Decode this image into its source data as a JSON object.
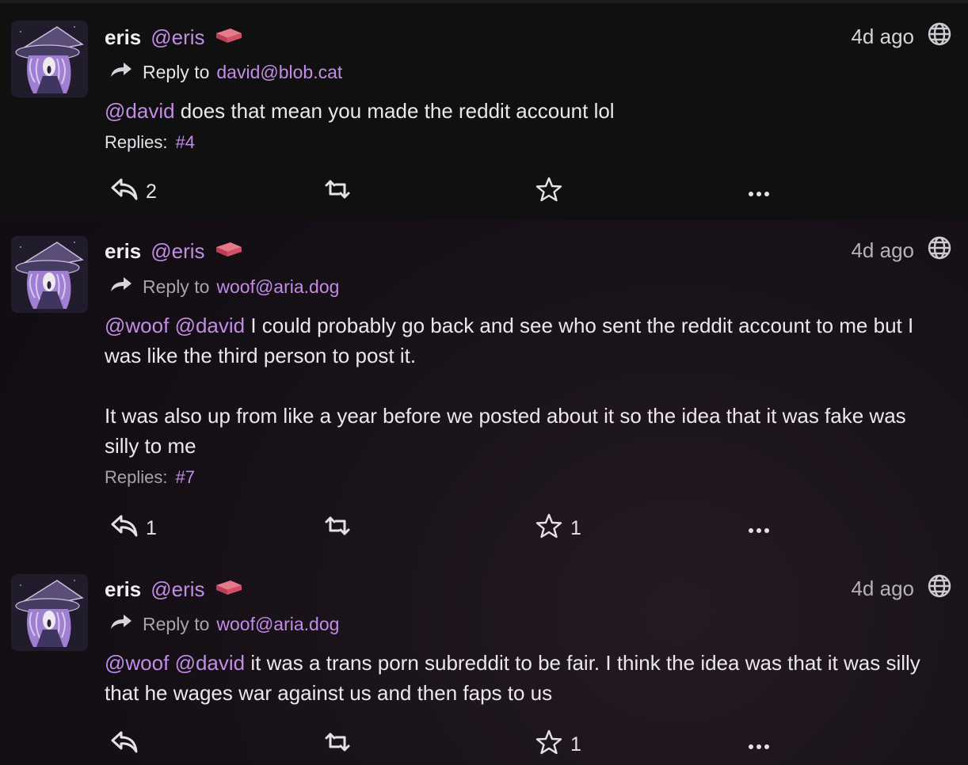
{
  "posts": [
    {
      "display_name": "eris",
      "username": "@eris",
      "badge_icon": "brick-emoji",
      "time": "4d ago",
      "visibility_icon": "globe-icon",
      "reply_label": "Reply to",
      "reply_target": "david@blob.cat",
      "mentions": [
        "@david"
      ],
      "text": " does that mean you made the reddit account lol",
      "replies_label": "Replies:",
      "replies_link": "#4",
      "reply_count": "2",
      "repeat_count": "",
      "fav_count": ""
    },
    {
      "display_name": "eris",
      "username": "@eris",
      "badge_icon": "brick-emoji",
      "time": "4d ago",
      "visibility_icon": "globe-icon",
      "reply_label": "Reply to",
      "reply_target": "woof@aria.dog",
      "mentions": [
        "@woof",
        "@david"
      ],
      "text": " I could probably go back and see who sent the reddit account to me but I was like the third person to post it.",
      "text2": "It was also up from like a year before we posted about it so the idea that it was fake was silly to me",
      "replies_label": "Replies:",
      "replies_link": "#7",
      "reply_count": "1",
      "repeat_count": "",
      "fav_count": "1"
    },
    {
      "display_name": "eris",
      "username": "@eris",
      "badge_icon": "brick-emoji",
      "time": "4d ago",
      "visibility_icon": "globe-icon",
      "reply_label": "Reply to",
      "reply_target": "woof@aria.dog",
      "mentions": [
        "@woof",
        "@david"
      ],
      "text": " it was a trans porn subreddit to be fair. I think the idea was that it was silly that he wages war against us and then faps to us",
      "reply_count": "",
      "repeat_count": "",
      "fav_count": "1"
    }
  ],
  "colors": {
    "accent": "#c38ce6",
    "background": "#120d14",
    "first_post_background": "#111011",
    "text": "#ece7ee"
  },
  "icons": [
    "reply-icon",
    "repeat-icon",
    "star-icon",
    "more-icon",
    "globe-icon",
    "reply-to-arrow-icon",
    "brick-emoji"
  ]
}
